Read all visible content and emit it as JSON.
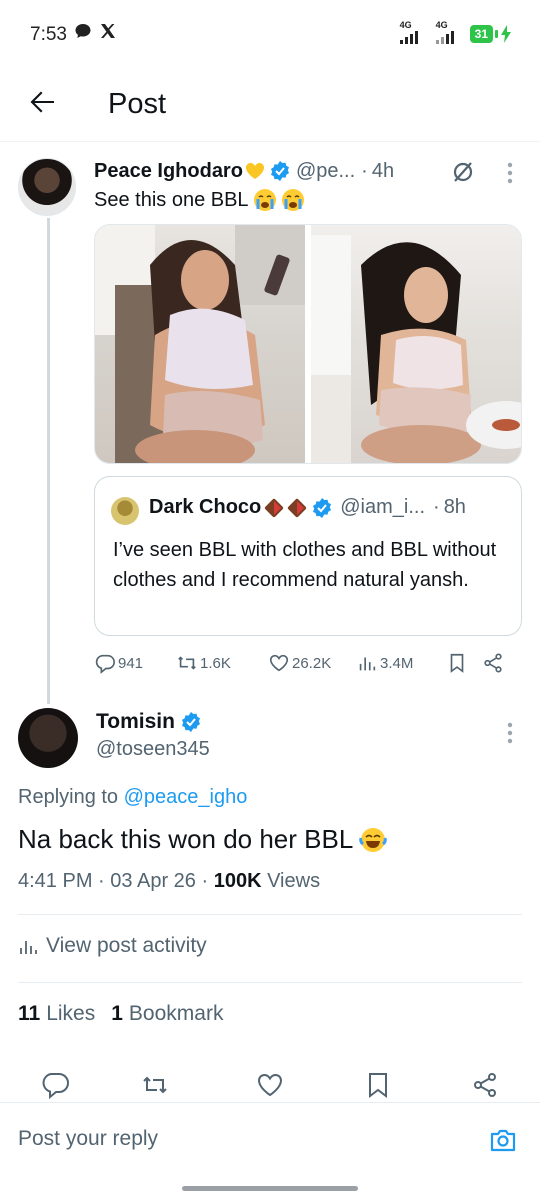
{
  "status_bar": {
    "time": "7:53",
    "network1": "4G",
    "network2": "4G",
    "battery": "31"
  },
  "header": {
    "title": "Post"
  },
  "parent_post": {
    "name": "Peace Ighodaro",
    "handle": "@pe...",
    "dot": "·",
    "time": "4h",
    "text": "See this one BBL",
    "quote": {
      "name": "Dark Choco",
      "handle": "@iam_i...",
      "dot": "·",
      "time": "8h",
      "text": "I’ve seen BBL with clothes and BBL without clothes and I recommend natural yansh."
    },
    "actions": {
      "replies": "941",
      "reposts": "1.6K",
      "likes": "26.2K",
      "views": "3.4M"
    }
  },
  "main_post": {
    "name": "Tomisin",
    "handle": "@toseen345",
    "replying_prefix": "Replying to",
    "replying_to": "@peace_igho",
    "text": "Na back this won do her BBL",
    "time": "4:41 PM",
    "dot1": "·",
    "date": "03 Apr 26",
    "dot2": "·",
    "views_count": "100K",
    "views_label": "Views",
    "activity_label": "View post activity",
    "likes_count": "11",
    "likes_label": "Likes",
    "bookmarks_count": "1",
    "bookmarks_label": "Bookmark"
  },
  "reply": {
    "placeholder": "Post your reply"
  },
  "colors": {
    "accent": "#1d9bf0",
    "muted": "#536471",
    "text": "#0f1419",
    "battery": "#2ec44a"
  }
}
